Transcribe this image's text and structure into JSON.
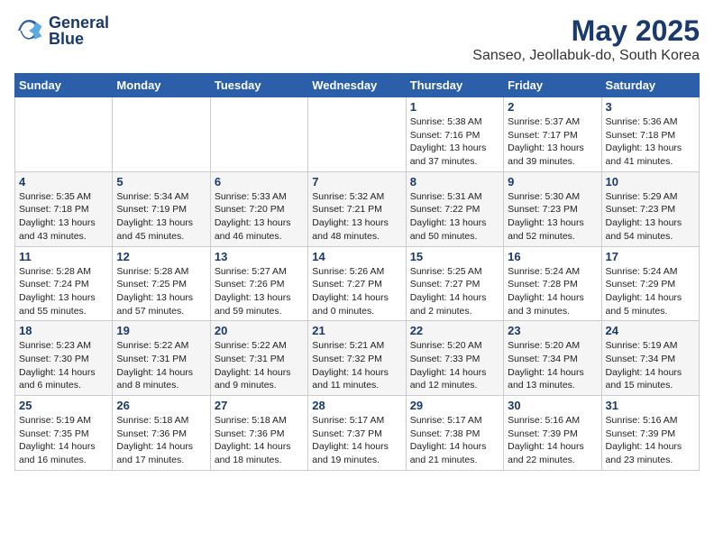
{
  "header": {
    "logo_line1": "General",
    "logo_line2": "Blue",
    "title": "May 2025",
    "subtitle": "Sanseo, Jeollabuk-do, South Korea"
  },
  "weekdays": [
    "Sunday",
    "Monday",
    "Tuesday",
    "Wednesday",
    "Thursday",
    "Friday",
    "Saturday"
  ],
  "weeks": [
    [
      {
        "day": "",
        "info": ""
      },
      {
        "day": "",
        "info": ""
      },
      {
        "day": "",
        "info": ""
      },
      {
        "day": "",
        "info": ""
      },
      {
        "day": "1",
        "info": "Sunrise: 5:38 AM\nSunset: 7:16 PM\nDaylight: 13 hours\nand 37 minutes."
      },
      {
        "day": "2",
        "info": "Sunrise: 5:37 AM\nSunset: 7:17 PM\nDaylight: 13 hours\nand 39 minutes."
      },
      {
        "day": "3",
        "info": "Sunrise: 5:36 AM\nSunset: 7:18 PM\nDaylight: 13 hours\nand 41 minutes."
      }
    ],
    [
      {
        "day": "4",
        "info": "Sunrise: 5:35 AM\nSunset: 7:18 PM\nDaylight: 13 hours\nand 43 minutes."
      },
      {
        "day": "5",
        "info": "Sunrise: 5:34 AM\nSunset: 7:19 PM\nDaylight: 13 hours\nand 45 minutes."
      },
      {
        "day": "6",
        "info": "Sunrise: 5:33 AM\nSunset: 7:20 PM\nDaylight: 13 hours\nand 46 minutes."
      },
      {
        "day": "7",
        "info": "Sunrise: 5:32 AM\nSunset: 7:21 PM\nDaylight: 13 hours\nand 48 minutes."
      },
      {
        "day": "8",
        "info": "Sunrise: 5:31 AM\nSunset: 7:22 PM\nDaylight: 13 hours\nand 50 minutes."
      },
      {
        "day": "9",
        "info": "Sunrise: 5:30 AM\nSunset: 7:23 PM\nDaylight: 13 hours\nand 52 minutes."
      },
      {
        "day": "10",
        "info": "Sunrise: 5:29 AM\nSunset: 7:23 PM\nDaylight: 13 hours\nand 54 minutes."
      }
    ],
    [
      {
        "day": "11",
        "info": "Sunrise: 5:28 AM\nSunset: 7:24 PM\nDaylight: 13 hours\nand 55 minutes."
      },
      {
        "day": "12",
        "info": "Sunrise: 5:28 AM\nSunset: 7:25 PM\nDaylight: 13 hours\nand 57 minutes."
      },
      {
        "day": "13",
        "info": "Sunrise: 5:27 AM\nSunset: 7:26 PM\nDaylight: 13 hours\nand 59 minutes."
      },
      {
        "day": "14",
        "info": "Sunrise: 5:26 AM\nSunset: 7:27 PM\nDaylight: 14 hours\nand 0 minutes."
      },
      {
        "day": "15",
        "info": "Sunrise: 5:25 AM\nSunset: 7:27 PM\nDaylight: 14 hours\nand 2 minutes."
      },
      {
        "day": "16",
        "info": "Sunrise: 5:24 AM\nSunset: 7:28 PM\nDaylight: 14 hours\nand 3 minutes."
      },
      {
        "day": "17",
        "info": "Sunrise: 5:24 AM\nSunset: 7:29 PM\nDaylight: 14 hours\nand 5 minutes."
      }
    ],
    [
      {
        "day": "18",
        "info": "Sunrise: 5:23 AM\nSunset: 7:30 PM\nDaylight: 14 hours\nand 6 minutes."
      },
      {
        "day": "19",
        "info": "Sunrise: 5:22 AM\nSunset: 7:31 PM\nDaylight: 14 hours\nand 8 minutes."
      },
      {
        "day": "20",
        "info": "Sunrise: 5:22 AM\nSunset: 7:31 PM\nDaylight: 14 hours\nand 9 minutes."
      },
      {
        "day": "21",
        "info": "Sunrise: 5:21 AM\nSunset: 7:32 PM\nDaylight: 14 hours\nand 11 minutes."
      },
      {
        "day": "22",
        "info": "Sunrise: 5:20 AM\nSunset: 7:33 PM\nDaylight: 14 hours\nand 12 minutes."
      },
      {
        "day": "23",
        "info": "Sunrise: 5:20 AM\nSunset: 7:34 PM\nDaylight: 14 hours\nand 13 minutes."
      },
      {
        "day": "24",
        "info": "Sunrise: 5:19 AM\nSunset: 7:34 PM\nDaylight: 14 hours\nand 15 minutes."
      }
    ],
    [
      {
        "day": "25",
        "info": "Sunrise: 5:19 AM\nSunset: 7:35 PM\nDaylight: 14 hours\nand 16 minutes."
      },
      {
        "day": "26",
        "info": "Sunrise: 5:18 AM\nSunset: 7:36 PM\nDaylight: 14 hours\nand 17 minutes."
      },
      {
        "day": "27",
        "info": "Sunrise: 5:18 AM\nSunset: 7:36 PM\nDaylight: 14 hours\nand 18 minutes."
      },
      {
        "day": "28",
        "info": "Sunrise: 5:17 AM\nSunset: 7:37 PM\nDaylight: 14 hours\nand 19 minutes."
      },
      {
        "day": "29",
        "info": "Sunrise: 5:17 AM\nSunset: 7:38 PM\nDaylight: 14 hours\nand 21 minutes."
      },
      {
        "day": "30",
        "info": "Sunrise: 5:16 AM\nSunset: 7:39 PM\nDaylight: 14 hours\nand 22 minutes."
      },
      {
        "day": "31",
        "info": "Sunrise: 5:16 AM\nSunset: 7:39 PM\nDaylight: 14 hours\nand 23 minutes."
      }
    ]
  ]
}
